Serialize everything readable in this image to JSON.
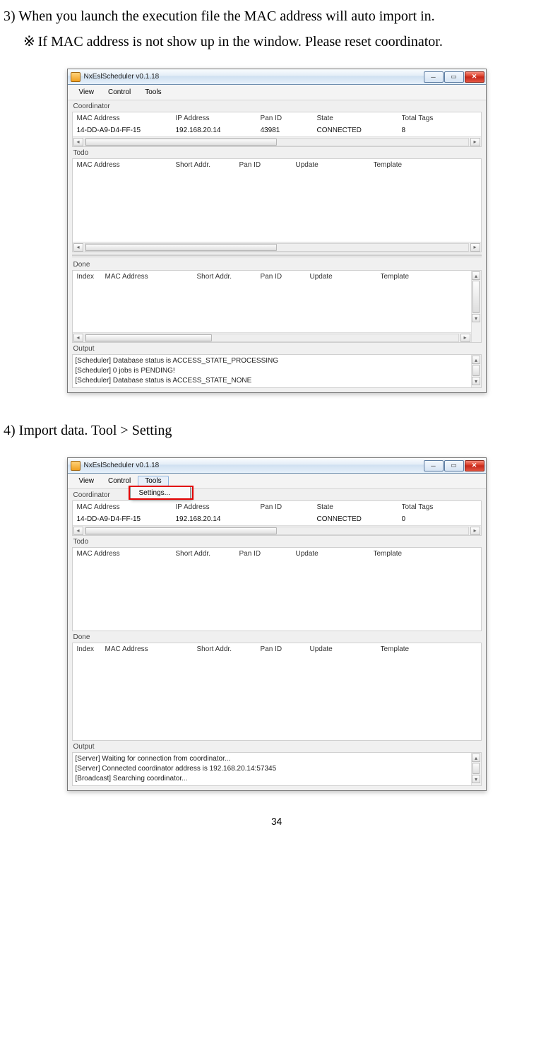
{
  "doc": {
    "step3_num": "3)",
    "step3_text": "When you launch the execution file the MAC address will auto import in.",
    "step3_note_marker": "※",
    "step3_note": "If MAC address is not show up in the window. Please reset coordinator.",
    "step4_num": "4)",
    "step4_text": "Import data. Tool > Setting",
    "page_number": "34"
  },
  "win": {
    "title": "NxEslScheduler v0.1.18",
    "menus": {
      "view": "View",
      "control": "Control",
      "tools": "Tools"
    },
    "dropdown": {
      "settings": "Settings..."
    },
    "labels": {
      "coordinator": "Coordinator",
      "todo": "Todo",
      "done": "Done",
      "output": "Output"
    },
    "coord_headers": {
      "mac": "MAC Address",
      "ip": "IP Address",
      "pan": "Pan ID",
      "state": "State",
      "tags": "Total Tags"
    },
    "todo_headers": {
      "mac": "MAC Address",
      "sa": "Short Addr.",
      "pan": "Pan ID",
      "upd": "Update",
      "tpl": "Template"
    },
    "done_headers": {
      "idx": "Index",
      "mac": "MAC Address",
      "sa": "Short Addr.",
      "pan": "Pan ID",
      "upd": "Update",
      "tpl": "Template"
    }
  },
  "win1": {
    "coord_row": {
      "mac": "14-DD-A9-D4-FF-15",
      "ip": "192.168.20.14",
      "pan": "43981",
      "state": "CONNECTED",
      "tags": "8"
    },
    "output_lines": {
      "l1": "[Scheduler] Database status is ACCESS_STATE_PROCESSING",
      "l2": "[Scheduler] 0 jobs is PENDING!",
      "l3": "[Scheduler] Database status is ACCESS_STATE_NONE"
    }
  },
  "win2": {
    "coord_row": {
      "mac": "14-DD-A9-D4-FF-15",
      "ip": "192.168.20.14",
      "pan": "",
      "state": "CONNECTED",
      "tags": "0"
    },
    "output_lines": {
      "l1": "[Server] Waiting for connection from coordinator...",
      "l2": "[Server] Connected coordinator address is 192.168.20.14:57345",
      "l3": "[Broadcast] Searching coordinator..."
    }
  }
}
